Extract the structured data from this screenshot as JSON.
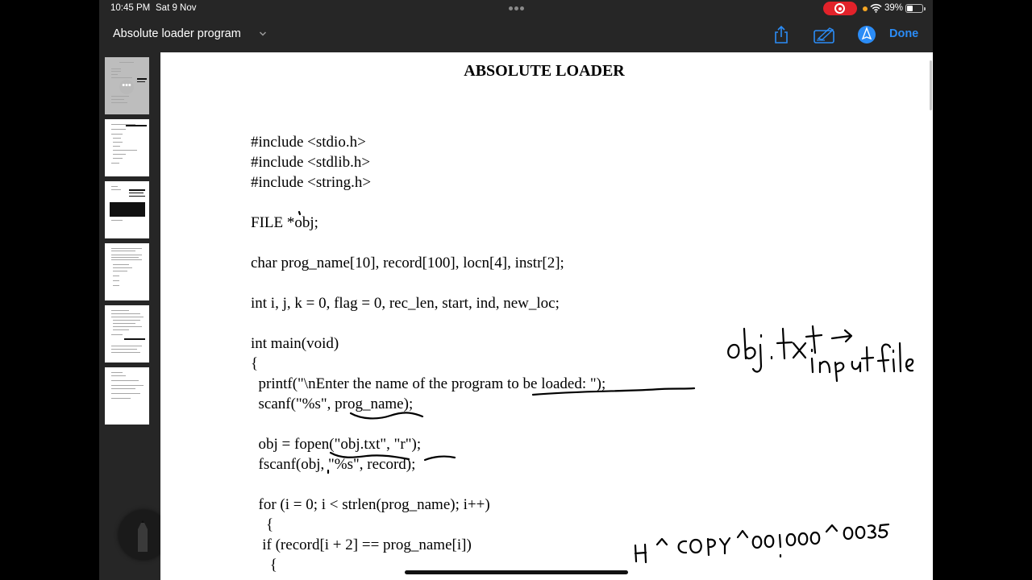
{
  "status_bar": {
    "time": "10:45 PM",
    "date": "Sat 9 Nov",
    "battery_percent": "39%",
    "battery_level": 0.39,
    "icons": [
      "screen-record-icon",
      "wifi-icon",
      "battery-icon"
    ]
  },
  "toolbar": {
    "document_title": "Absolute loader program",
    "done_label": "Done",
    "icons": [
      "share-icon",
      "markup-icon",
      "pencil-tip-icon"
    ],
    "accent_color": "#2b8cf6"
  },
  "document": {
    "heading": "ABSOLUTE LOADER",
    "code_lines": [
      "#include <stdio.h>",
      "#include <stdlib.h>",
      "#include <string.h>",
      "FILE *obj;",
      "char prog_name[10], record[100], locn[4], instr[2];",
      "int i, j, k = 0, flag = 0, rec_len, start, ind, new_loc;",
      "int main(void)",
      "{",
      "  printf(\"\\nEnter the name of the program to be loaded: \");",
      "  scanf(\"%s\", prog_name);",
      "  obj = fopen(\"obj.txt\", \"r\");",
      "  fscanf(obj, \"%s\", record);",
      "  for (i = 0; i < strlen(prog_name); i++)",
      "    {",
      "   if (record[i + 2] == prog_name[i])",
      "     {"
    ],
    "handwritten_notes": [
      "obj.txt → input file",
      "H ^ COPY ^ 001000 ^ 0035"
    ]
  },
  "thumbnails": {
    "count": 6,
    "selected_index": 0,
    "more_label": "•••"
  }
}
